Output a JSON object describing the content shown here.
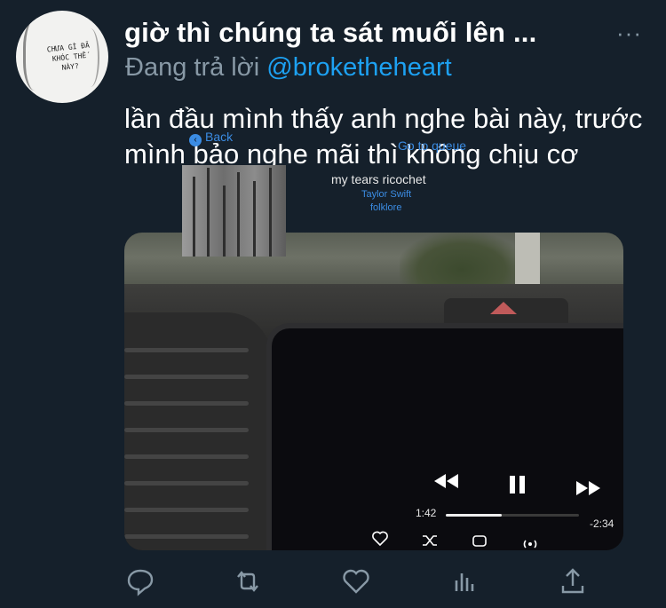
{
  "tweet": {
    "display_name": "giờ thì chúng ta sát muối lên ...",
    "more_icon": "more-dots-icon",
    "replying_prefix": "Đang trả lời",
    "replying_handle": "@broketheheart",
    "text": "lần đầu mình thấy anh nghe bài này, trước mình bảo nghe mãi thì không chịu cơ",
    "avatar_text": "CHƯA GÌ ĐÃ KHÓC THẾ NÀY?"
  },
  "media": {
    "back_label": "Back",
    "queue_label": "Go to queue",
    "track": "my tears ricochet",
    "artist": "Taylor Swift",
    "album": "folklore",
    "time_elapsed": "1:42",
    "time_remaining": "-2:34",
    "progress": 0.42
  },
  "actions": [
    "reply-icon",
    "retweet-icon",
    "like-icon",
    "analytics-icon",
    "share-icon"
  ],
  "colors": {
    "background": "#15202b",
    "accent": "#1da1f2",
    "muted": "#8899a6",
    "player_accent": "#3b8ce3"
  }
}
